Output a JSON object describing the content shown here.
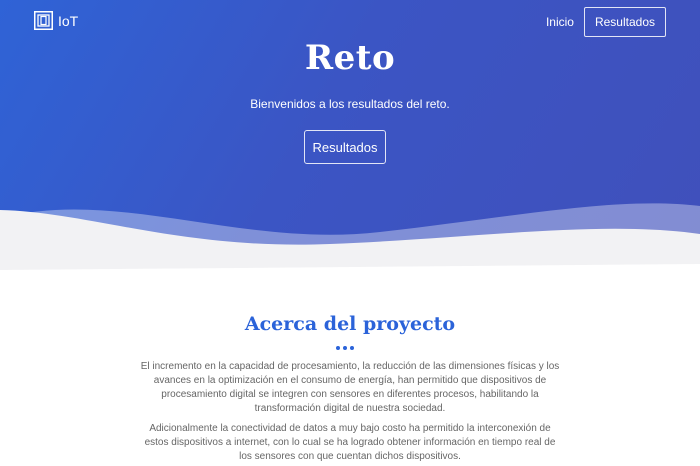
{
  "brand": {
    "name": "IoT",
    "icon": "logo-icon"
  },
  "nav": {
    "home_label": "Inicio",
    "results_label": "Resultados"
  },
  "hero": {
    "title": "Reto",
    "subtitle": "Bienvenidos a los resultados del reto.",
    "button_label": "Resultados"
  },
  "about": {
    "title": "Acerca del proyecto",
    "paragraph_1": "El incremento en la capacidad de procesamiento, la reducción de las dimensiones físicas y los avances en la optimización en el consumo de energía, han permitido que dispositivos de procesamiento digital se integren con sensores en diferentes procesos, habilitando la transformación digital de nuestra sociedad.",
    "paragraph_2": "Adicionalmente la conectividad de datos a muy bajo costo ha permitido la interconexión de estos dispositivos a internet, con lo cual se ha logrado obtener información en tiempo real de los sensores con que cuentan dichos dispositivos."
  },
  "colors": {
    "hero_start": "#2f63d6",
    "hero_end": "#4050bb",
    "accent": "#2b63d9",
    "text_muted": "#666666"
  }
}
